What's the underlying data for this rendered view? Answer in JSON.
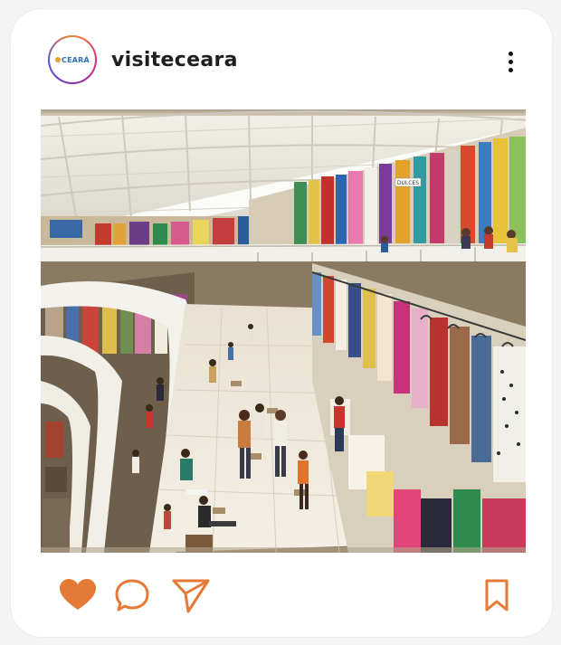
{
  "post": {
    "username": "visiteceara",
    "avatar_text": "CEARÁ",
    "photo_alt": "Interior of a crowded two-level market hall with clothing stalls",
    "store_sign": "DULCES"
  },
  "actions": {
    "like_icon": "heart-icon",
    "comment_icon": "comment-icon",
    "share_icon": "send-icon",
    "save_icon": "bookmark-icon"
  },
  "colors": {
    "accent": "#e47a35",
    "text": "#1e1e1e",
    "card": "#ffffff"
  }
}
